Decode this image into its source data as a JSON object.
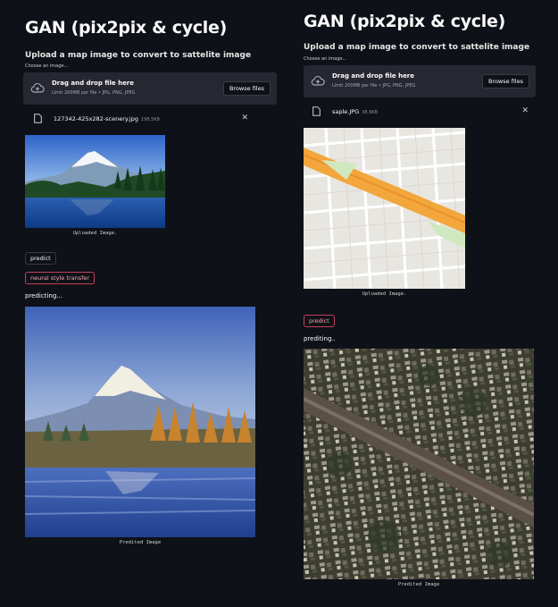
{
  "left": {
    "title": "GAN (pix2pix & cycle)",
    "upload_label": "Upload a map image to convert to sattelite image",
    "choose_label": "Choose an image...",
    "dropzone": {
      "main_text": "Drag and drop file here",
      "sub_text": "Limit 200MB per file • JPG, PNG, JPEG",
      "browse_label": "Browse files"
    },
    "file": {
      "name": "127342-425x282-scenery.jpg",
      "size": "198.5KB"
    },
    "uploaded_caption": "Uploaded Image.",
    "predict_label": "predict",
    "nst_label": "neural style transfer",
    "status": "predicting...",
    "predicted_caption": "Predited Image"
  },
  "right": {
    "title": "GAN (pix2pix & cycle)",
    "upload_label": "Upload a map image to convert to sattelite image",
    "choose_label": "Choose an image...",
    "dropzone": {
      "main_text": "Drag and drop file here",
      "sub_text": "Limit 200MB per file • JPG, PNG, JPEG",
      "browse_label": "Browse files"
    },
    "file": {
      "name": "saple.JPG",
      "size": "38.9KB"
    },
    "uploaded_caption": "Uploaded Image.",
    "predict_label": "predict",
    "status": "prediting..",
    "predicted_caption": "Predited Image"
  },
  "colors": {
    "background": "#0e1117",
    "widget_bg": "#262730",
    "active_border": "#c5405a",
    "text": "#fafafa"
  },
  "icons": [
    "cloud-upload-icon",
    "file-icon",
    "close-icon"
  ]
}
